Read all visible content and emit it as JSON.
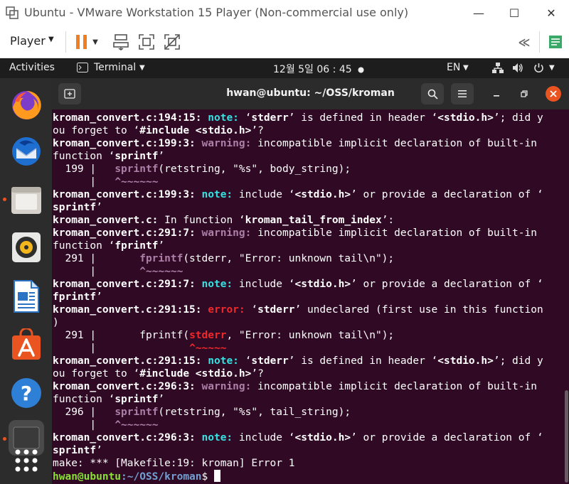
{
  "vmware": {
    "title": "Ubuntu - VMware Workstation 15 Player (Non-commercial use only)",
    "player_menu": "Player",
    "minimize": "—",
    "maximize": "☐",
    "close": "✕"
  },
  "panel": {
    "activities": "Activities",
    "app_menu": "Terminal",
    "clock": "12월 5일  06 : 45",
    "language": "EN"
  },
  "dock": {
    "items": [
      "Firefox",
      "Thunderbird",
      "Files",
      "Rhythmbox",
      "LibreOffice Writer",
      "Ubuntu Software",
      "Help",
      "Terminal",
      "Show Applications"
    ]
  },
  "terminal": {
    "title": "hwan@ubuntu: ~/OSS/kroman",
    "lines": [
      [
        {
          "t": "kroman_convert.c:194:15: ",
          "c": "b"
        },
        {
          "t": "note: ",
          "c": "note"
        },
        {
          "t": "‘"
        },
        {
          "t": "stderr",
          "c": "b"
        },
        {
          "t": "’ is defined in header ‘"
        },
        {
          "t": "<stdio.h>",
          "c": "b"
        },
        {
          "t": "’; did y"
        }
      ],
      [
        {
          "t": "ou forget to ‘"
        },
        {
          "t": "#include <stdio.h>",
          "c": "b"
        },
        {
          "t": "’?"
        }
      ],
      [
        {
          "t": "kroman_convert.c:199:3: ",
          "c": "b"
        },
        {
          "t": "warning: ",
          "c": "warn"
        },
        {
          "t": "incompatible implicit declaration of built-in"
        }
      ],
      [
        {
          "t": "function ‘"
        },
        {
          "t": "sprintf",
          "c": "b"
        },
        {
          "t": "’"
        }
      ],
      [
        {
          "t": "  199 |   "
        },
        {
          "t": "sprintf",
          "c": "fn-purple"
        },
        {
          "t": "(retstring, \"%s\", body_string);"
        }
      ],
      [
        {
          "t": "      |   "
        },
        {
          "t": "^~~~~~~",
          "c": "caret-purple"
        }
      ],
      [
        {
          "t": "kroman_convert.c:199:3: ",
          "c": "b"
        },
        {
          "t": "note: ",
          "c": "note"
        },
        {
          "t": "include ‘"
        },
        {
          "t": "<stdio.h>",
          "c": "b"
        },
        {
          "t": "’ or provide a declaration of ‘"
        }
      ],
      [
        {
          "t": "sprintf",
          "c": "b"
        },
        {
          "t": "’"
        }
      ],
      [
        {
          "t": "kroman_convert.c: ",
          "c": "b"
        },
        {
          "t": "In function ‘"
        },
        {
          "t": "kroman_tail_from_index",
          "c": "b"
        },
        {
          "t": "’:"
        }
      ],
      [
        {
          "t": "kroman_convert.c:291:7: ",
          "c": "b"
        },
        {
          "t": "warning: ",
          "c": "warn"
        },
        {
          "t": "incompatible implicit declaration of built-in"
        }
      ],
      [
        {
          "t": "function ‘"
        },
        {
          "t": "fprintf",
          "c": "b"
        },
        {
          "t": "’"
        }
      ],
      [
        {
          "t": "  291 |       "
        },
        {
          "t": "fprintf",
          "c": "fn-purple"
        },
        {
          "t": "(stderr, \"Error: unknown tail\\n\");"
        }
      ],
      [
        {
          "t": "      |       "
        },
        {
          "t": "^~~~~~~",
          "c": "caret-purple"
        }
      ],
      [
        {
          "t": "kroman_convert.c:291:7: ",
          "c": "b"
        },
        {
          "t": "note: ",
          "c": "note"
        },
        {
          "t": "include ‘"
        },
        {
          "t": "<stdio.h>",
          "c": "b"
        },
        {
          "t": "’ or provide a declaration of ‘"
        }
      ],
      [
        {
          "t": "fprintf",
          "c": "b"
        },
        {
          "t": "’"
        }
      ],
      [
        {
          "t": "kroman_convert.c:291:15: ",
          "c": "b"
        },
        {
          "t": "error: ",
          "c": "err"
        },
        {
          "t": "‘"
        },
        {
          "t": "stderr",
          "c": "b"
        },
        {
          "t": "’ undeclared (first use in this function"
        }
      ],
      [
        {
          "t": ")"
        }
      ],
      [
        {
          "t": "  291 |       fprintf("
        },
        {
          "t": "stderr",
          "c": "err-red"
        },
        {
          "t": ", \"Error: unknown tail\\n\");"
        }
      ],
      [
        {
          "t": "      |               "
        },
        {
          "t": "^~~~~~",
          "c": "err-red"
        }
      ],
      [
        {
          "t": "kroman_convert.c:291:15: ",
          "c": "b"
        },
        {
          "t": "note: ",
          "c": "note"
        },
        {
          "t": "‘"
        },
        {
          "t": "stderr",
          "c": "b"
        },
        {
          "t": "’ is defined in header ‘"
        },
        {
          "t": "<stdio.h>",
          "c": "b"
        },
        {
          "t": "’; did y"
        }
      ],
      [
        {
          "t": "ou forget to ‘"
        },
        {
          "t": "#include <stdio.h>",
          "c": "b"
        },
        {
          "t": "’?"
        }
      ],
      [
        {
          "t": "kroman_convert.c:296:3: ",
          "c": "b"
        },
        {
          "t": "warning: ",
          "c": "warn"
        },
        {
          "t": "incompatible implicit declaration of built-in"
        }
      ],
      [
        {
          "t": "function ‘"
        },
        {
          "t": "sprintf",
          "c": "b"
        },
        {
          "t": "’"
        }
      ],
      [
        {
          "t": "  296 |   "
        },
        {
          "t": "sprintf",
          "c": "fn-purple"
        },
        {
          "t": "(retstring, \"%s\", tail_string);"
        }
      ],
      [
        {
          "t": "      |   "
        },
        {
          "t": "^~~~~~~",
          "c": "caret-purple"
        }
      ],
      [
        {
          "t": "kroman_convert.c:296:3: ",
          "c": "b"
        },
        {
          "t": "note: ",
          "c": "note"
        },
        {
          "t": "include ‘"
        },
        {
          "t": "<stdio.h>",
          "c": "b"
        },
        {
          "t": "’ or provide a declaration of ‘"
        }
      ],
      [
        {
          "t": "sprintf",
          "c": "b"
        },
        {
          "t": "’"
        }
      ],
      [
        {
          "t": "make: *** [Makefile:19: kroman] Error 1"
        }
      ]
    ],
    "prompt": {
      "user": "hwan@ubuntu",
      "path": ":~/OSS/kroman",
      "symbol": "$ "
    }
  },
  "colors": {
    "terminal_bg": "#300a24",
    "note": "#34e2e2",
    "warning": "#ad7fa8",
    "error": "#ef2929",
    "prompt_user": "#8ae234",
    "prompt_path": "#729fcf",
    "accent": "#e95420"
  }
}
